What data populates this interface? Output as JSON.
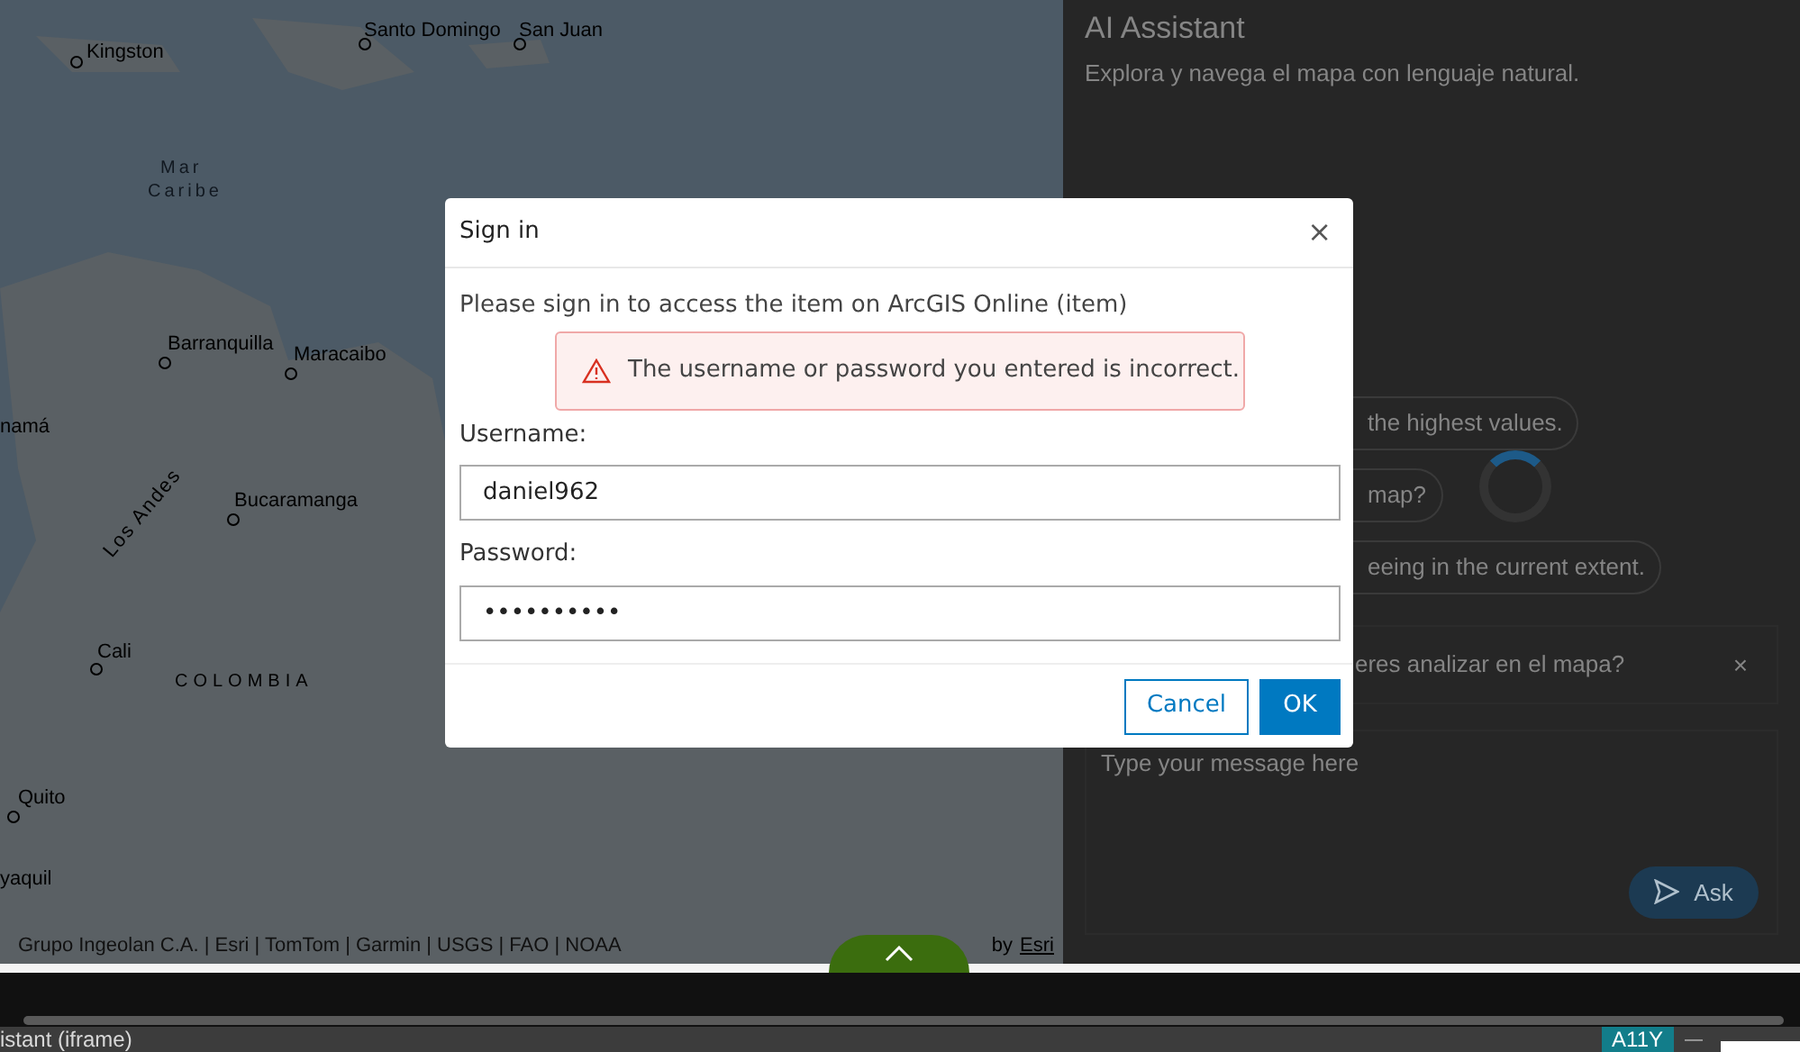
{
  "map": {
    "labels": [
      {
        "text": "Kingston",
        "kind": "city"
      },
      {
        "text": "Santo Domingo",
        "kind": "city"
      },
      {
        "text": "San Juan",
        "kind": "city"
      },
      {
        "text": "Mar",
        "kind": "water"
      },
      {
        "text": "Caribe",
        "kind": "water"
      },
      {
        "text": "Barranquilla",
        "kind": "city"
      },
      {
        "text": "Maracaibo",
        "kind": "city"
      },
      {
        "text": "namá",
        "kind": "city"
      },
      {
        "text": "Bucaramanga",
        "kind": "city"
      },
      {
        "text": "Los Andes",
        "kind": "range"
      },
      {
        "text": "Cali",
        "kind": "city"
      },
      {
        "text": "COLOMBIA",
        "kind": "country"
      },
      {
        "text": "Quito",
        "kind": "city"
      },
      {
        "text": "yaquil",
        "kind": "city"
      }
    ],
    "attribution": "Grupo Ingeolan C.A. | Esri | TomTom | Garmin | USGS | FAO | NOAA",
    "powered_by": "by",
    "powered_link": "Esri"
  },
  "assistant": {
    "title": "AI Assistant",
    "subtitle": "Explora y navega el mapa con lenguaje natural.",
    "suggestions": [
      "the highest values.",
      "map?",
      "eeing in the current extent."
    ],
    "question": "eres analizar en el mapa?",
    "close": "×",
    "message": {
      "placeholder": "Type your message here"
    },
    "ask": "Ask"
  },
  "dialog": {
    "title": "Sign in",
    "close": "×",
    "message": "Please sign in to access the item on ArcGIS Online (item)",
    "error": "The username or password you entered is incorrect.",
    "username_label": "Username:",
    "username": {
      "value": "daniel962"
    },
    "password_label": "Password:",
    "password": {
      "value": "••••••••••"
    },
    "buttons": [
      {
        "label": "Cancel",
        "kind": "secondary"
      },
      {
        "label": "OK",
        "kind": "primary"
      }
    ]
  },
  "status_bar": {
    "label": "istant (iframe)",
    "badge": "A11Y",
    "minimize": "—"
  }
}
